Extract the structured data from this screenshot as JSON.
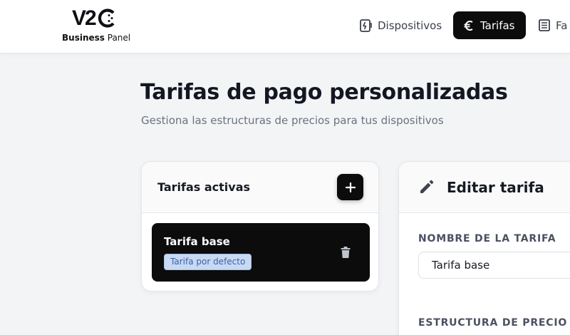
{
  "brand": {
    "logo_mark": "V2",
    "sub_bold": "Business",
    "sub_regular": "Panel"
  },
  "nav": {
    "devices": {
      "label": "Dispositivos",
      "icon": "devices-icon"
    },
    "tariffs": {
      "label": "Tarifas",
      "icon": "euro-icon",
      "active": true
    },
    "billing": {
      "label": "Fa",
      "icon": "receipt-icon"
    }
  },
  "page": {
    "title": "Tarifas de pago personalizadas",
    "subtitle": "Gestiona las estructuras de precios para tus dispositivos"
  },
  "active_tariffs": {
    "title": "Tarifas activas",
    "add_label": "+",
    "items": [
      {
        "name": "Tarifa base",
        "badge": "Tarifa por defecto",
        "selected": true
      }
    ]
  },
  "editor": {
    "title": "Editar tarifa",
    "name_label": "NOMBRE DE LA TARIFA",
    "name_value": "Tarifa base",
    "structure_label": "ESTRUCTURA DE PRECIO"
  },
  "colors": {
    "accent": "#0c0c0d",
    "background": "#f3f4f6",
    "badge_bg": "#c8d9f2",
    "badge_text": "#3a62b0"
  }
}
